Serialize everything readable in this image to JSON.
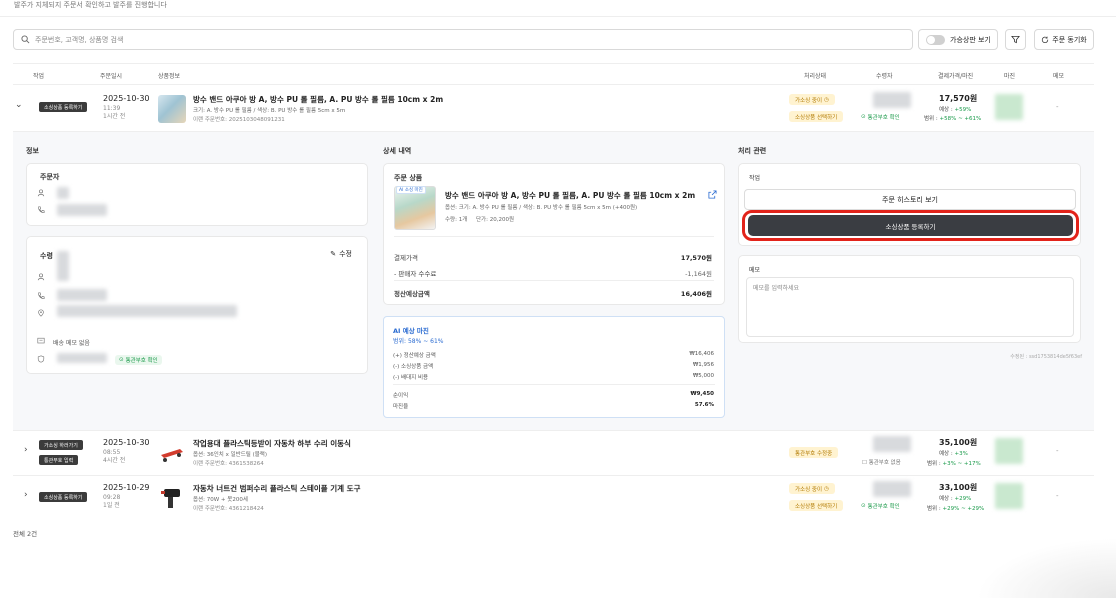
{
  "notice": "발주가 지체되지 주문서 확인하고 발주를 진행합니다",
  "toolbar": {
    "search_placeholder": "주문번호, 고객명, 상품명 검색",
    "toggle_label": "가승상판 보기",
    "sync_label": "주문 동기화"
  },
  "columns": [
    "작업",
    "주문일시",
    "상품정보",
    "처리상태",
    "수령자",
    "결제가격/마진",
    "마진",
    "메모"
  ],
  "orders": [
    {
      "action": "소싱상품 등록하기",
      "date": "2025-10-30",
      "time": "11:39",
      "ago": "1시간 전",
      "name": "방수 밴드 아쿠아 방 A, 방수 PU 롤 필름, A. PU 방수 롤 필름 10cm x 2m",
      "option": "크기: A. 방수 PU 롤 필름 / 색상: B. PU 방수 롤 필름 5cm x 5m",
      "order_id": "이랜 주문번호: 2025103048091231",
      "status": "가소싱 중이",
      "status2": "소싱상품 선택하기",
      "recipient_check": "통관부호 확인",
      "price": "17,570원",
      "margin1": "예상 : ",
      "margin1_val": "+59%",
      "margin2": "범위 : ",
      "margin2_val": "+58% ~ +61%",
      "memo": "-"
    },
    {
      "action": "가소싱 하러가기",
      "action2": "통관부호 입력",
      "date": "2025-10-30",
      "time": "08:55",
      "ago": "4시간 전",
      "name": "작업용대 플라스틱등받이 자동차 하부 수리 이동식",
      "option": "옵션: 36인치 x 일반드릴 (블랙)",
      "order_id": "이랜 주문번호: 4361538264",
      "status": "통관부호 수정중",
      "recipient_check": "통관부호 없음",
      "price": "35,100원",
      "margin1": "예상 : ",
      "margin1_val": "+3%",
      "margin2": "범위 : ",
      "margin2_val": "+3% ~ +17%",
      "memo": "-"
    },
    {
      "action": "소싱상품 등록하기",
      "date": "2025-10-29",
      "time": "09:28",
      "ago": "1일 전",
      "name": "자동차 너트건 범퍼수리 플라스틱 스테이플 기계 도구",
      "option": "옵션: 70W + 못200세",
      "order_id": "이랜 주문번호: 4361218424",
      "status": "가소싱 중이",
      "status2": "소싱상품 선택하기",
      "recipient_check": "통관부호 확인",
      "price": "33,100원",
      "margin1": "예상 : ",
      "margin1_val": "+29%",
      "margin2": "범위 : ",
      "margin2_val": "+29% ~ +29%",
      "memo": "-"
    }
  ],
  "detail": {
    "info_title": "정보",
    "orderer_title": "주문자",
    "recipient_title": "수령",
    "edit_label": "수정",
    "delivery_memo": "배송 메모 없음",
    "customs_check": "통관부호 확인",
    "detail_title": "상세 내역",
    "product_title": "주문 상품",
    "product_tag": "AI 소싱 마진",
    "product_name": "방수 밴드 아쿠아 방 A, 방수 PU 롤 필름, A. PU 방수 롤 필름 10cm x 2m",
    "product_option": "옵션: 크기: A. 방수 PU 롤 필름 / 색상: B. PU 방수 롤 필름 5cm x 5m (+400원)",
    "product_qty": "수량: 1개",
    "product_unit": "단가: 20,200원",
    "pay_label": "결제가격",
    "pay_value": "17,570원",
    "fee_label": "- 판매자 수수료",
    "fee_value": "-1,164원",
    "settle_label": "정산예상금액",
    "settle_value": "16,406원",
    "ai_title": "AI 예상 마진",
    "ai_range": "범위: 58% ~ 61%",
    "ai_rows": [
      {
        "label": "(+) 정산예상 금액",
        "value": "₩16,406"
      },
      {
        "label": "(-) 소싱상품 금액",
        "value": "₩1,956"
      },
      {
        "label": "(-) 배대지 비용",
        "value": "₩5,000"
      }
    ],
    "profit_label": "순이익",
    "profit_value": "₩9,450",
    "margin_label": "마진율",
    "margin_value": "57.6%",
    "process_title": "처리 관련",
    "task_title": "작업",
    "history_btn": "주문 히스토리 보기",
    "register_btn": "소싱상품 등록하기",
    "memo_title": "메모",
    "memo_placeholder": "메모를 입력하세요",
    "modified": "수정된 : ssd1753814de5f63ef"
  },
  "total": "전체 2건"
}
